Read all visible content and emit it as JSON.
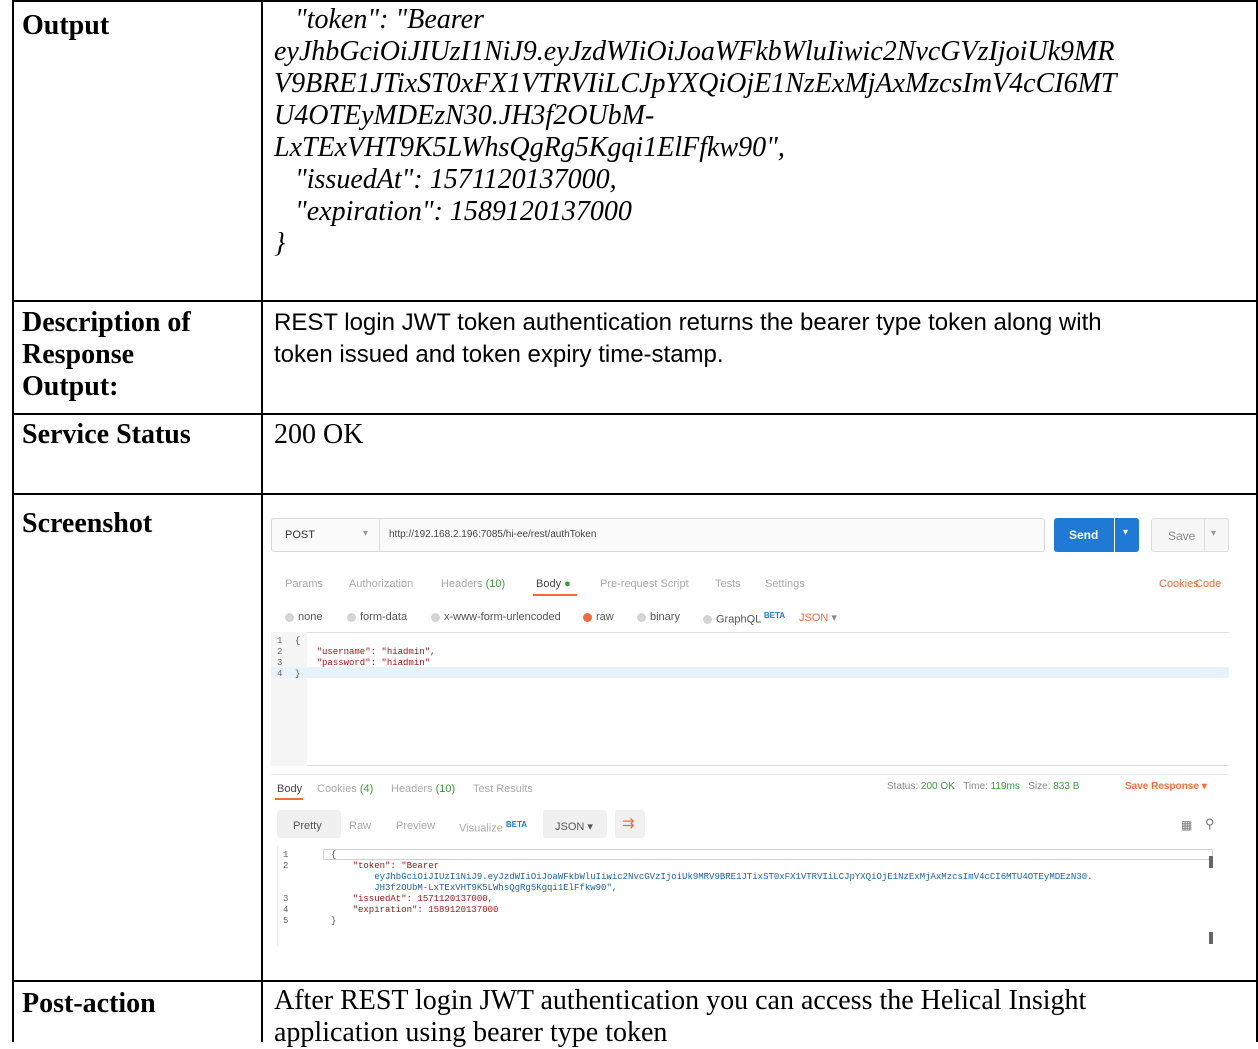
{
  "rows": {
    "output": {
      "label": "Output",
      "lines": [
        "   \"token\": \"Bearer",
        "eyJhbGciOiJIUzI1NiJ9.eyJzdWIiOiJoaWFkbWluIiwic2NvcGVzIjoiUk9MR",
        "V9BRE1JTixST0xFX1VTRVIiLCJpYXQiOjE1NzExMjAxMzcsImV4cCI6MT",
        "U4OTEyMDEzN30.JH3f2OUbM-",
        "LxTExVHT9K5LWhsQgRg5Kgqi1ElFfkw90\",",
        "   \"issuedAt\": 1571120137000,",
        "   \"expiration\": 1589120137000",
        "}"
      ]
    },
    "description": {
      "label_lines": [
        "Description of",
        "Response",
        "Output:"
      ],
      "lines": [
        "REST login JWT token authentication returns the bearer type token along with",
        "token issued and token expiry time-stamp."
      ]
    },
    "status": {
      "label": "Service Status",
      "value": "200 OK"
    },
    "screenshot": {
      "label": "Screenshot"
    },
    "post_action": {
      "label": "Post-action",
      "lines": [
        "After REST login JWT authentication you can access the Helical Insight",
        "application using bearer type token"
      ]
    }
  },
  "postman": {
    "method": "POST",
    "url": "http://192.168.2.196:7085/hi-ee/rest/authToken",
    "send_label": "Send",
    "save_label": "Save",
    "req_tabs": {
      "params": "Params",
      "authorization": "Authorization",
      "headers": "Headers",
      "headers_count": "(10)",
      "body": "Body",
      "prerequest": "Pre-request Script",
      "tests": "Tests",
      "settings": "Settings"
    },
    "cookies_link": "Cookies",
    "code_link": "Code",
    "body_types": {
      "none": "none",
      "formdata": "form-data",
      "urlencoded": "x-www-form-urlencoded",
      "raw": "raw",
      "binary": "binary",
      "graphql": "GraphQL",
      "beta": "BETA",
      "json": "JSON"
    },
    "request_code": [
      {
        "n": "1",
        "t": "{"
      },
      {
        "n": "2",
        "t": "    \"username\": \"hiadmin\","
      },
      {
        "n": "3",
        "t": "    \"password\": \"hiadmin\""
      },
      {
        "n": "4",
        "t": "}"
      }
    ],
    "resp_tabs": {
      "body": "Body",
      "cookies": "Cookies",
      "cookies_count": "(4)",
      "headers": "Headers",
      "headers_count": "(10)",
      "tests": "Test Results"
    },
    "status_label": "Status:",
    "status_value": "200 OK",
    "time_label": "Time:",
    "time_value": "119ms",
    "size_label": "Size:",
    "size_value": "833 B",
    "save_response": "Save Response",
    "view_tabs": {
      "pretty": "Pretty",
      "raw": "Raw",
      "preview": "Preview",
      "visualize": "Visualize",
      "beta": "BETA",
      "json": "JSON"
    },
    "response_code": [
      {
        "n": "1",
        "t": "{"
      },
      {
        "n": "2",
        "t": "    \"token\": \"Bearer"
      },
      {
        "n": "",
        "t": "        eyJhbGciOiJIUzI1NiJ9.eyJzdWIiOiJoaWFkbWluIiwic2NvcGVzIjoiUk9MRV9BRE1JTixST0xFX1VTRVIiLCJpYXQiOjE1NzExMjAxMzcsImV4cCI6MTU4OTEyMDEzN30."
      },
      {
        "n": "",
        "t": "        JH3f2OUbM-LxTExVHT9K5LWhsQgRg5Kgqi1ElFfkw90\","
      },
      {
        "n": "3",
        "t": "    \"issuedAt\": 1571120137000,"
      },
      {
        "n": "4",
        "t": "    \"expiration\": 1589120137000"
      },
      {
        "n": "5",
        "t": "}"
      }
    ]
  }
}
